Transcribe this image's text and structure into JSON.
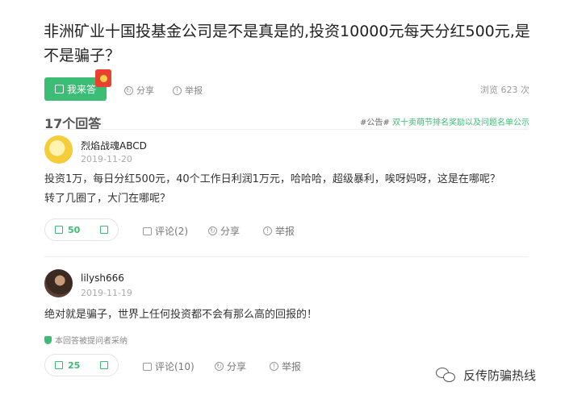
{
  "question": {
    "title": "非洲矿业十国投基金公司是不是真是的,投资10000元每天分红500元,是不是骗子？",
    "answer_button": "我来答",
    "share": "分享",
    "report": "举报",
    "views": "浏览 623 次"
  },
  "answers_header": {
    "count": "17个回答",
    "notice_tag": "#公告#",
    "notice_text": "双十卖萌节排名奖励以及问题名单公示"
  },
  "answers": [
    {
      "username": "烈焰战魂ABCD",
      "date": "2019-11-20",
      "content_line1": "投资1万，每日分红500元，40个工作日利润1万元，哈哈哈，超级暴利，唉呀妈呀，这是在哪呢？",
      "content_line2": "转了几圈了，大门在哪呢？",
      "votes": "50",
      "comments": "评论(2)",
      "share": "分享",
      "report": "举报"
    },
    {
      "username": "lilysh666",
      "date": "2019-11-19",
      "content_line1": "绝对就是骗子，世界上任何投资都不会有那么高的回报的！",
      "adopted": "本回答被提问者采纳",
      "votes": "25",
      "comments": "评论(10)",
      "share": "分享",
      "report": "举报"
    }
  ],
  "watermark": "反传防骗热线",
  "colors": {
    "accent": "#3bbd75",
    "red_packet": "#e8412f"
  }
}
